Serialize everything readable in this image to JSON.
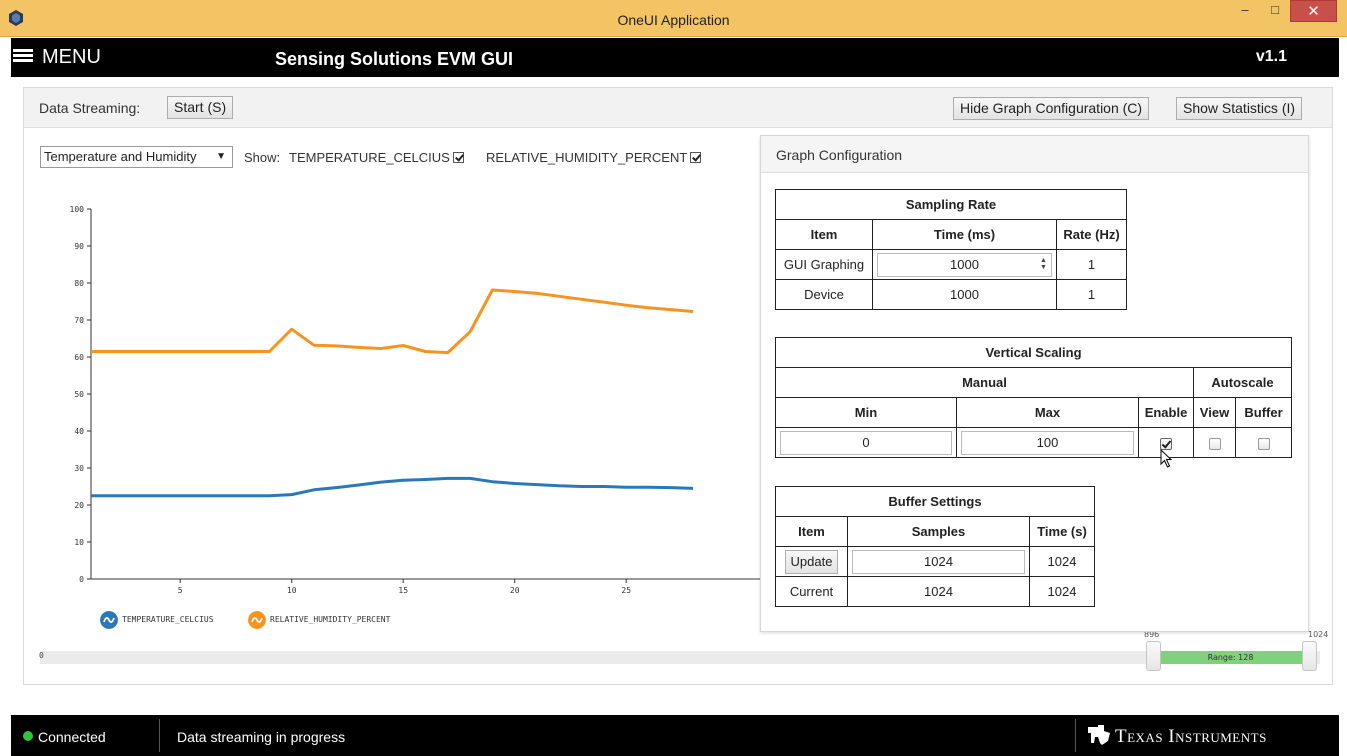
{
  "window": {
    "title": "OneUI Application",
    "controls": {
      "minimize": "–",
      "maximize": "□",
      "close": "✕"
    }
  },
  "header": {
    "menu_label": "MENU",
    "app_title": "Sensing Solutions EVM GUI",
    "version": "v1.1"
  },
  "toolbar": {
    "streaming_label": "Data Streaming:",
    "start_button": "Start (S)",
    "hide_config_button": "Hide Graph Configuration (C)",
    "show_stats_button": "Show Statistics (I)"
  },
  "graph_controls": {
    "graph_select": "Temperature and Humidity",
    "show_label": "Show:",
    "series_toggles": [
      {
        "label": "TEMPERATURE_CELCIUS",
        "checked": true
      },
      {
        "label": "RELATIVE_HUMIDITY_PERCENT",
        "checked": true
      }
    ]
  },
  "chart_data": {
    "type": "line",
    "xlim": [
      1,
      31
    ],
    "ylim": [
      0,
      100
    ],
    "y_ticks": [
      0,
      10,
      20,
      30,
      40,
      50,
      60,
      70,
      80,
      90,
      100
    ],
    "x_ticks": [
      5,
      10,
      15,
      20,
      25
    ],
    "legend_position": "bottom-left",
    "series": [
      {
        "name": "TEMPERATURE_CELCIUS",
        "color": "#2b78b8",
        "x": [
          1,
          2,
          3,
          4,
          5,
          6,
          7,
          8,
          9,
          10,
          11,
          12,
          13,
          14,
          15,
          16,
          17,
          18,
          19,
          20,
          21,
          22,
          23,
          24,
          25,
          26,
          27,
          28
        ],
        "values": [
          22.5,
          22.5,
          22.5,
          22.5,
          22.5,
          22.5,
          22.5,
          22.5,
          22.5,
          22.8,
          24.1,
          24.7,
          25.4,
          26.2,
          26.7,
          26.9,
          27.2,
          27.2,
          26.3,
          25.8,
          25.5,
          25.2,
          25.0,
          25.0,
          24.8,
          24.8,
          24.7,
          24.5
        ]
      },
      {
        "name": "RELATIVE_HUMIDITY_PERCENT",
        "color": "#f7931e",
        "x": [
          1,
          2,
          3,
          4,
          5,
          6,
          7,
          8,
          9,
          10,
          11,
          12,
          13,
          14,
          15,
          16,
          17,
          18,
          19,
          20,
          21,
          22,
          23,
          24,
          25,
          26,
          27,
          28
        ],
        "values": [
          61.5,
          61.5,
          61.5,
          61.5,
          61.5,
          61.5,
          61.5,
          61.5,
          61.5,
          67.5,
          63.2,
          63.0,
          62.6,
          62.3,
          63.1,
          61.5,
          61.2,
          66.8,
          78.1,
          77.7,
          77.2,
          76.4,
          75.6,
          74.8,
          74.0,
          73.3,
          72.8,
          72.3
        ]
      }
    ]
  },
  "range_slider": {
    "min_label": "0",
    "start": "896",
    "end": "1024",
    "range_label": "Range: 128"
  },
  "graph_config": {
    "title": "Graph Configuration",
    "sampling_rate": {
      "title": "Sampling Rate",
      "headers": [
        "Item",
        "Time (ms)",
        "Rate (Hz)"
      ],
      "rows": [
        {
          "item": "GUI Graphing",
          "time": "1000",
          "rate": "1"
        },
        {
          "item": "Device",
          "time": "1000",
          "rate": "1"
        }
      ]
    },
    "vertical_scaling": {
      "title": "Vertical Scaling",
      "manual_label": "Manual",
      "autoscale_label": "Autoscale",
      "headers": [
        "Min",
        "Max",
        "Enable",
        "View",
        "Buffer"
      ],
      "min": "0",
      "max": "100",
      "enable_checked": true,
      "view_checked": false,
      "buffer_checked": false
    },
    "buffer_settings": {
      "title": "Buffer Settings",
      "headers": [
        "Item",
        "Samples",
        "Time (s)"
      ],
      "update_button": "Update",
      "update_samples": "1024",
      "update_time": "1024",
      "current_label": "Current",
      "current_samples": "1024",
      "current_time": "1024"
    }
  },
  "status": {
    "connection": "Connected",
    "message": "Data streaming in progress",
    "brand": "Texas Instruments"
  }
}
